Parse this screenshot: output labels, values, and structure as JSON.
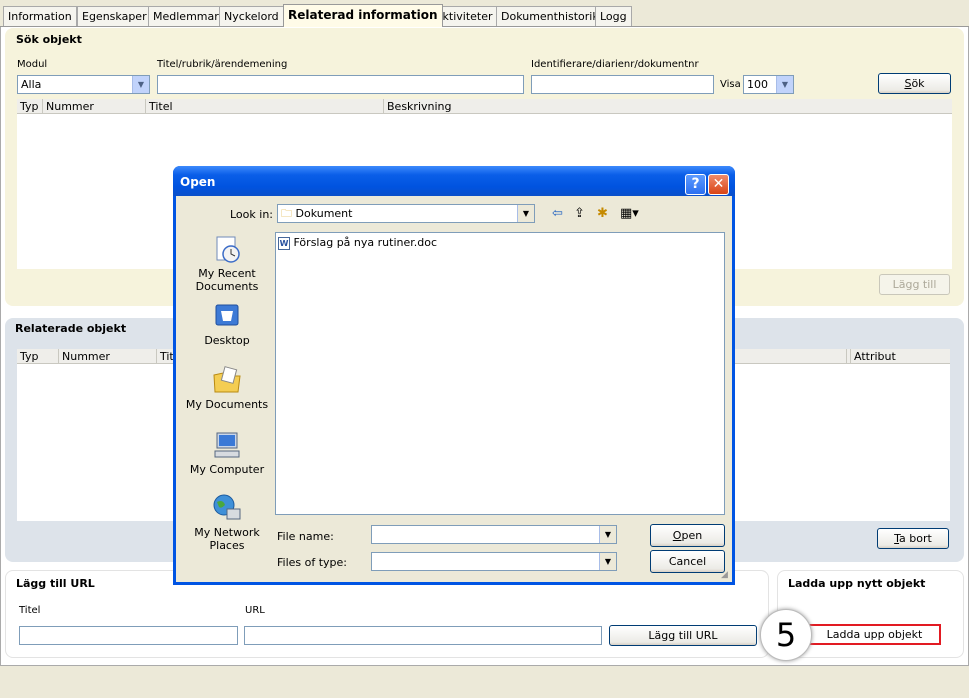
{
  "tabs": [
    "Information",
    "Egenskaper",
    "Medlemmar",
    "Nyckelord",
    "Relaterad information",
    "Aktiviteter",
    "Dokumenthistorik",
    "Logg"
  ],
  "search": {
    "title": "Sök objekt",
    "module_label": "Modul",
    "module_value": "Alla",
    "title_label": "Titel/rubrik/ärendemening",
    "title_value": "",
    "id_label": "Identifierare/diarienr/dokumentnr",
    "id_value": "",
    "show_label": "Visa",
    "show_value": "100",
    "search_button": "Sök",
    "columns": [
      "Typ",
      "Nummer",
      "Titel",
      "Beskrivning"
    ],
    "add_button": "Lägg till"
  },
  "related": {
    "title": "Relaterade objekt",
    "columns": [
      "Typ",
      "Nummer",
      "Tit",
      "Attribut"
    ],
    "remove_button": "Ta bort"
  },
  "url": {
    "title": "Lägg till URL",
    "title_label": "Titel",
    "url_label": "URL",
    "add_button": "Lägg till URL"
  },
  "upload": {
    "title": "Ladda upp nytt objekt",
    "button": "Ladda upp objekt",
    "step_number": "5"
  },
  "dialog": {
    "title": "Open",
    "help": "?",
    "close": "✕",
    "look_in_label": "Look in:",
    "look_in_value": "Dokument",
    "places": [
      {
        "label": "My Recent Documents",
        "icon": "recent-documents-icon"
      },
      {
        "label": "Desktop",
        "icon": "desktop-icon"
      },
      {
        "label": "My Documents",
        "icon": "my-documents-icon"
      },
      {
        "label": "My Computer",
        "icon": "my-computer-icon"
      },
      {
        "label": "My Network Places",
        "icon": "network-places-icon"
      }
    ],
    "files": [
      "Förslag på nya rutiner.doc"
    ],
    "file_name_label": "File name:",
    "file_name_value": "",
    "file_type_label": "Files of type:",
    "file_type_value": "",
    "open_button": "Open",
    "cancel_button": "Cancel"
  },
  "colors": {
    "highlight": "#e21a22",
    "dialog_title": "#0054e3",
    "yellow_panel": "#f6f3dc",
    "blue_panel": "#dde3ea"
  }
}
